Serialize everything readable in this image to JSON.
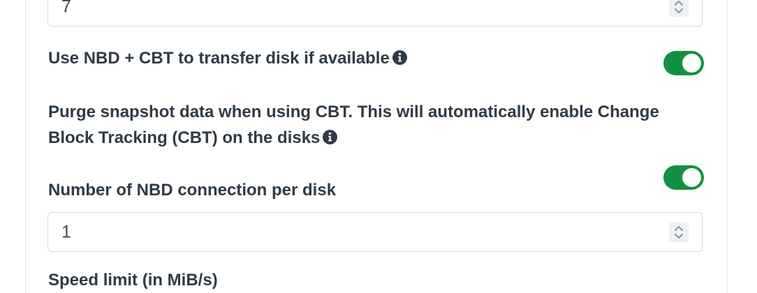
{
  "fields": {
    "top_input": {
      "value": "7"
    },
    "nbd_cbt": {
      "label": "Use NBD + CBT to transfer disk if available",
      "enabled": true
    },
    "purge_snapshot": {
      "label_line1": "Purge snapshot data when using CBT. This will automatically enable Change",
      "label_line2": "Block Tracking (CBT) on the disks",
      "enabled": true
    },
    "nbd_connections": {
      "label": "Number of NBD connection per disk",
      "value": "1"
    },
    "speed_limit": {
      "label": "Speed limit (in MiB/s)"
    }
  },
  "colors": {
    "toggle_on": "#139140",
    "text": "#2f3b46",
    "border": "#d5d9de"
  }
}
